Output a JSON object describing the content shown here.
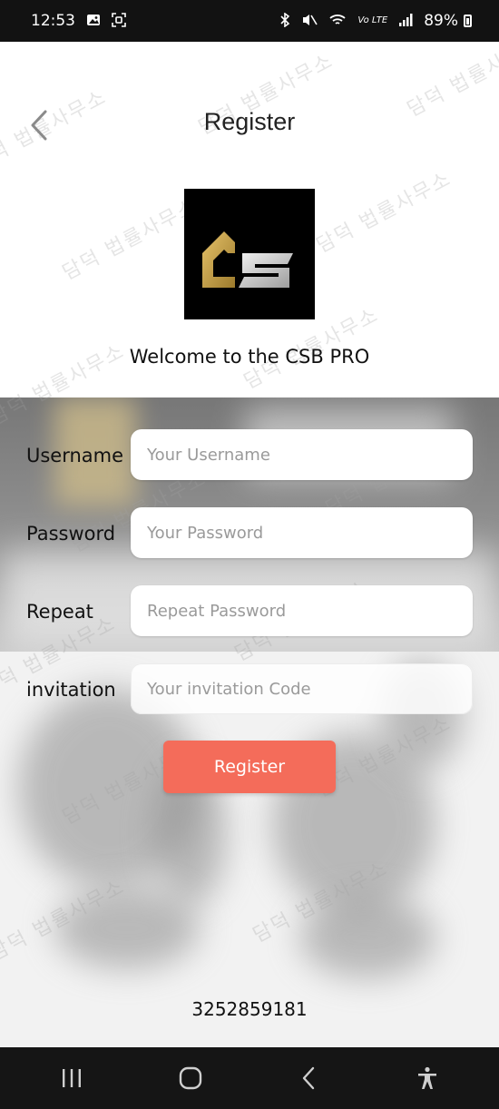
{
  "status_bar": {
    "time": "12:53",
    "network_type": "Vo LTE",
    "battery_percent": "89%",
    "icons": [
      "image-icon",
      "screenshot-icon",
      "bluetooth-icon",
      "mute-icon",
      "wifi-icon",
      "signal-icon",
      "battery-icon"
    ]
  },
  "header": {
    "title": "Register",
    "back_icon": "chevron-left-icon"
  },
  "logo": {
    "name": "csb-logo",
    "colors": {
      "background": "#000000",
      "gold": "#c9a24a",
      "silver": "#cfcfcf"
    }
  },
  "welcome_text": "Welcome to the CSB PRO",
  "form": {
    "fields": [
      {
        "label": "Username",
        "placeholder": "Your Username",
        "value": ""
      },
      {
        "label": "Password",
        "placeholder": "Your Password",
        "value": ""
      },
      {
        "label": "Repeat",
        "placeholder": "Repeat Password",
        "value": ""
      },
      {
        "label": "invitation",
        "placeholder": "Your invitation Code",
        "value": ""
      }
    ],
    "submit_label": "Register"
  },
  "device_number": "3252859181",
  "watermark_text": "담덕 법률사무소",
  "colors": {
    "accent": "#f46c5a",
    "status_bar": "#121212"
  },
  "nav_bar": {
    "icons": [
      "recents-icon",
      "home-icon",
      "back-icon",
      "accessibility-icon"
    ]
  }
}
